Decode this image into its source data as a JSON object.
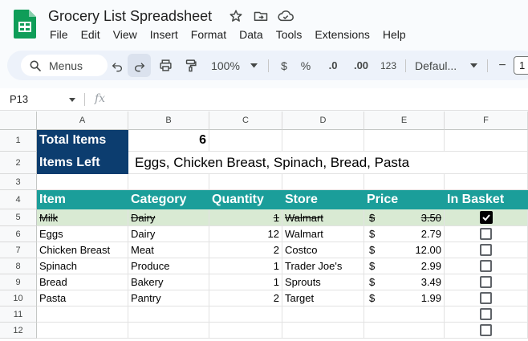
{
  "app": {
    "title": "Grocery List Spreadsheet",
    "menus": [
      "File",
      "Edit",
      "View",
      "Insert",
      "Format",
      "Data",
      "Tools",
      "Extensions",
      "Help"
    ]
  },
  "toolbar": {
    "search_label": "Menus",
    "zoom": "100%",
    "currency": "$",
    "percent": "%",
    "decrease_decimal": ".0",
    "increase_decimal": ".00",
    "number_format": "123",
    "font": "Defaul...",
    "font_size": "1",
    "minus": "−"
  },
  "formula_bar": {
    "name_box": "P13",
    "fx_label": "fx",
    "content": ""
  },
  "columns": [
    "A",
    "B",
    "C",
    "D",
    "E",
    "F"
  ],
  "rows": [
    "1",
    "2",
    "3",
    "4",
    "5",
    "6",
    "7",
    "8",
    "9",
    "10",
    "11",
    "12"
  ],
  "summary": {
    "total_label": "Total Items",
    "total_value": "6",
    "left_label": "Items Left",
    "left_value": "Eggs, Chicken Breast, Spinach, Bread, Pasta"
  },
  "table": {
    "headers": [
      "Item",
      "Category",
      "Quantity",
      "Store",
      "Price",
      "In Basket"
    ],
    "rows": [
      {
        "item": "Milk",
        "category": "Dairy",
        "quantity": "1",
        "store": "Walmart",
        "currency": "$",
        "price": "3.50",
        "in_basket": true
      },
      {
        "item": "Eggs",
        "category": "Dairy",
        "quantity": "12",
        "store": "Walmart",
        "currency": "$",
        "price": "2.79",
        "in_basket": false
      },
      {
        "item": "Chicken Breast",
        "category": "Meat",
        "quantity": "2",
        "store": "Costco",
        "currency": "$",
        "price": "12.00",
        "in_basket": false
      },
      {
        "item": "Spinach",
        "category": "Produce",
        "quantity": "1",
        "store": "Trader Joe's",
        "currency": "$",
        "price": "2.99",
        "in_basket": false
      },
      {
        "item": "Bread",
        "category": "Bakery",
        "quantity": "1",
        "store": "Sprouts",
        "currency": "$",
        "price": "3.49",
        "in_basket": false
      },
      {
        "item": "Pasta",
        "category": "Pantry",
        "quantity": "2",
        "store": "Target",
        "currency": "$",
        "price": "1.99",
        "in_basket": false
      }
    ]
  },
  "colors": {
    "summary_bg": "#0c3d6f",
    "header_bg": "#1b9e9a",
    "checked_row_bg": "#d9ead3"
  },
  "icons": [
    "sheets-logo-icon",
    "star-icon",
    "move-folder-icon",
    "cloud-saved-icon",
    "search-icon",
    "undo-icon",
    "redo-icon",
    "print-icon",
    "paint-format-icon",
    "dropdown-arrow-icon",
    "checkbox-checked-icon",
    "checkbox-empty-icon"
  ]
}
